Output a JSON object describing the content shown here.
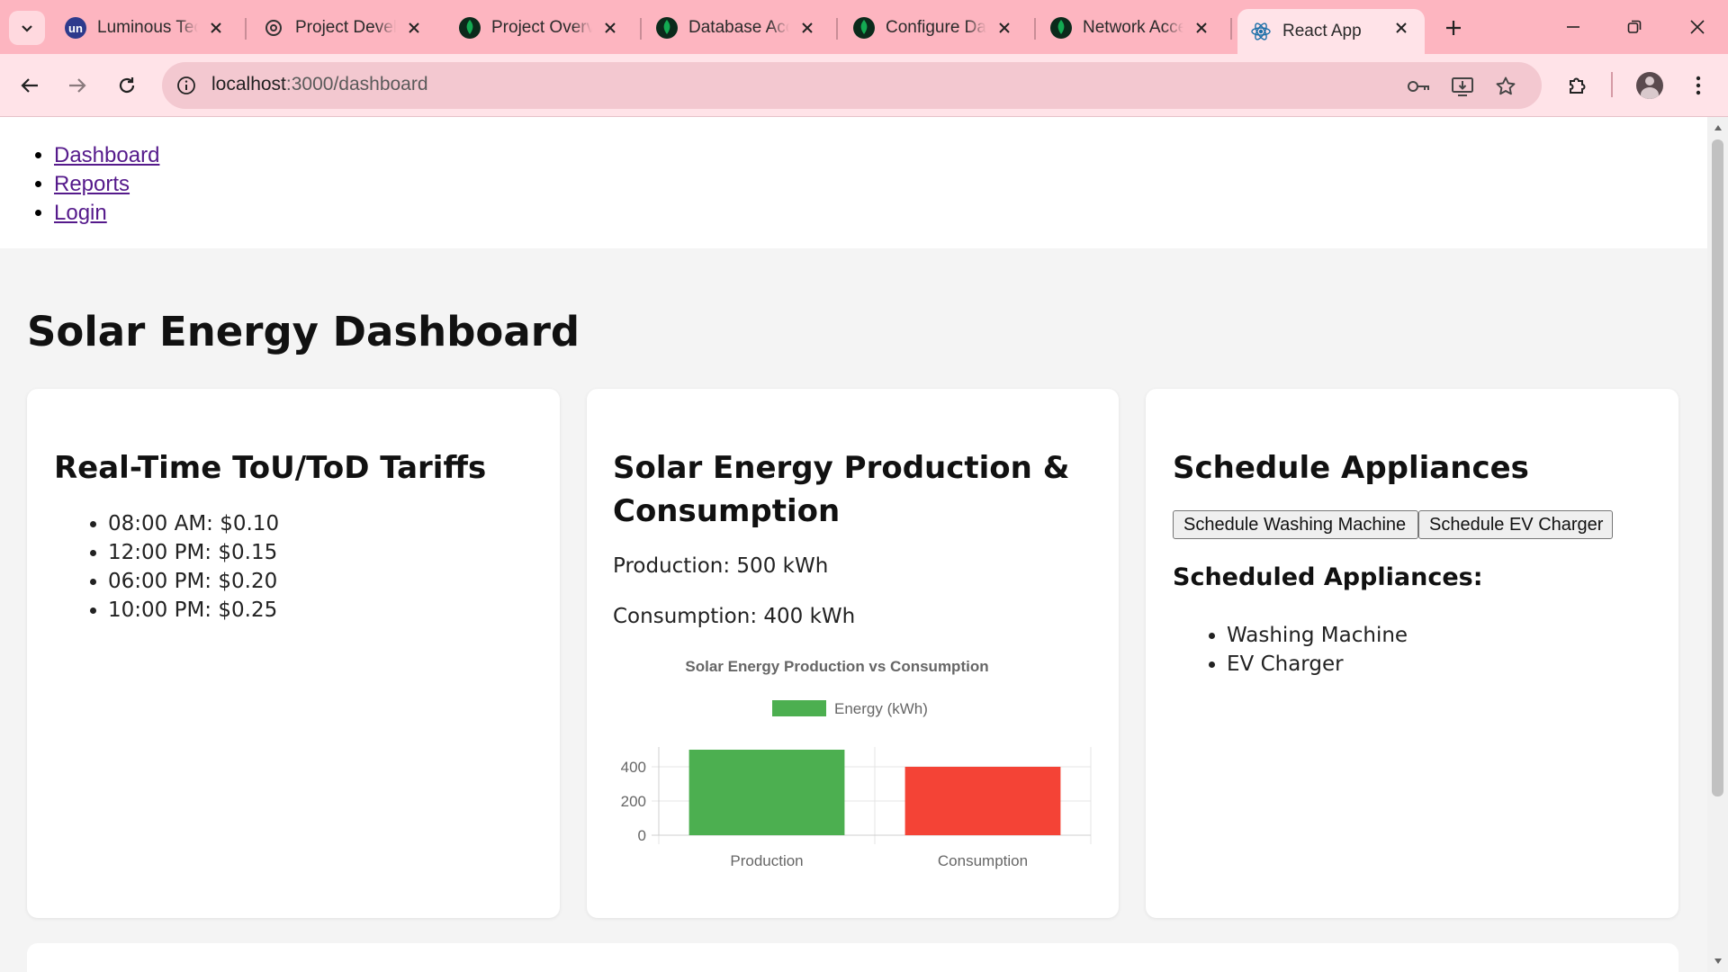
{
  "browser": {
    "tabs": [
      {
        "title": "Luminous Technologies",
        "icon": "un-logo-icon"
      },
      {
        "title": "Project Development",
        "icon": "openai-icon"
      },
      {
        "title": "Project Overview",
        "icon": "mongodb-leaf-icon"
      },
      {
        "title": "Database Access",
        "icon": "mongodb-leaf-icon"
      },
      {
        "title": "Configure Data",
        "icon": "mongodb-leaf-icon"
      },
      {
        "title": "Network Access",
        "icon": "mongodb-leaf-icon"
      },
      {
        "title": "React App",
        "icon": "react-icon",
        "active": true
      }
    ],
    "url": {
      "host": "localhost",
      "path": ":3000/dashboard"
    }
  },
  "nav": {
    "links": [
      "Dashboard",
      "Reports",
      "Login"
    ]
  },
  "page_title": "Solar Energy Dashboard",
  "tariffs": {
    "title": "Real-Time ToU/ToD Tariffs",
    "items": [
      "08:00 AM: $0.10",
      "12:00 PM: $0.15",
      "06:00 PM: $0.20",
      "10:00 PM: $0.25"
    ]
  },
  "energy": {
    "title_line1": "Solar Energy Production &",
    "title_line2": "Consumption",
    "production_text": "Production: 500 kWh",
    "consumption_text": "Consumption: 400 kWh"
  },
  "schedule": {
    "title": "Schedule Appliances",
    "buttons": [
      "Schedule Washing Machine",
      "Schedule EV Charger"
    ],
    "scheduled_title": "Scheduled Appliances:",
    "scheduled": [
      "Washing Machine",
      "EV Charger"
    ]
  },
  "chart_data": {
    "type": "bar",
    "title": "Solar Energy Production vs Consumption",
    "categories": [
      "Production",
      "Consumption"
    ],
    "series": [
      {
        "name": "Energy (kWh)",
        "values": [
          500,
          400
        ]
      }
    ],
    "colors": [
      "#4caf50",
      "#f44336"
    ],
    "legend_color": "#4caf50",
    "y_ticks": [
      0,
      200,
      400
    ],
    "ylim": [
      0,
      500
    ],
    "grid": true,
    "legend_position": "top"
  }
}
